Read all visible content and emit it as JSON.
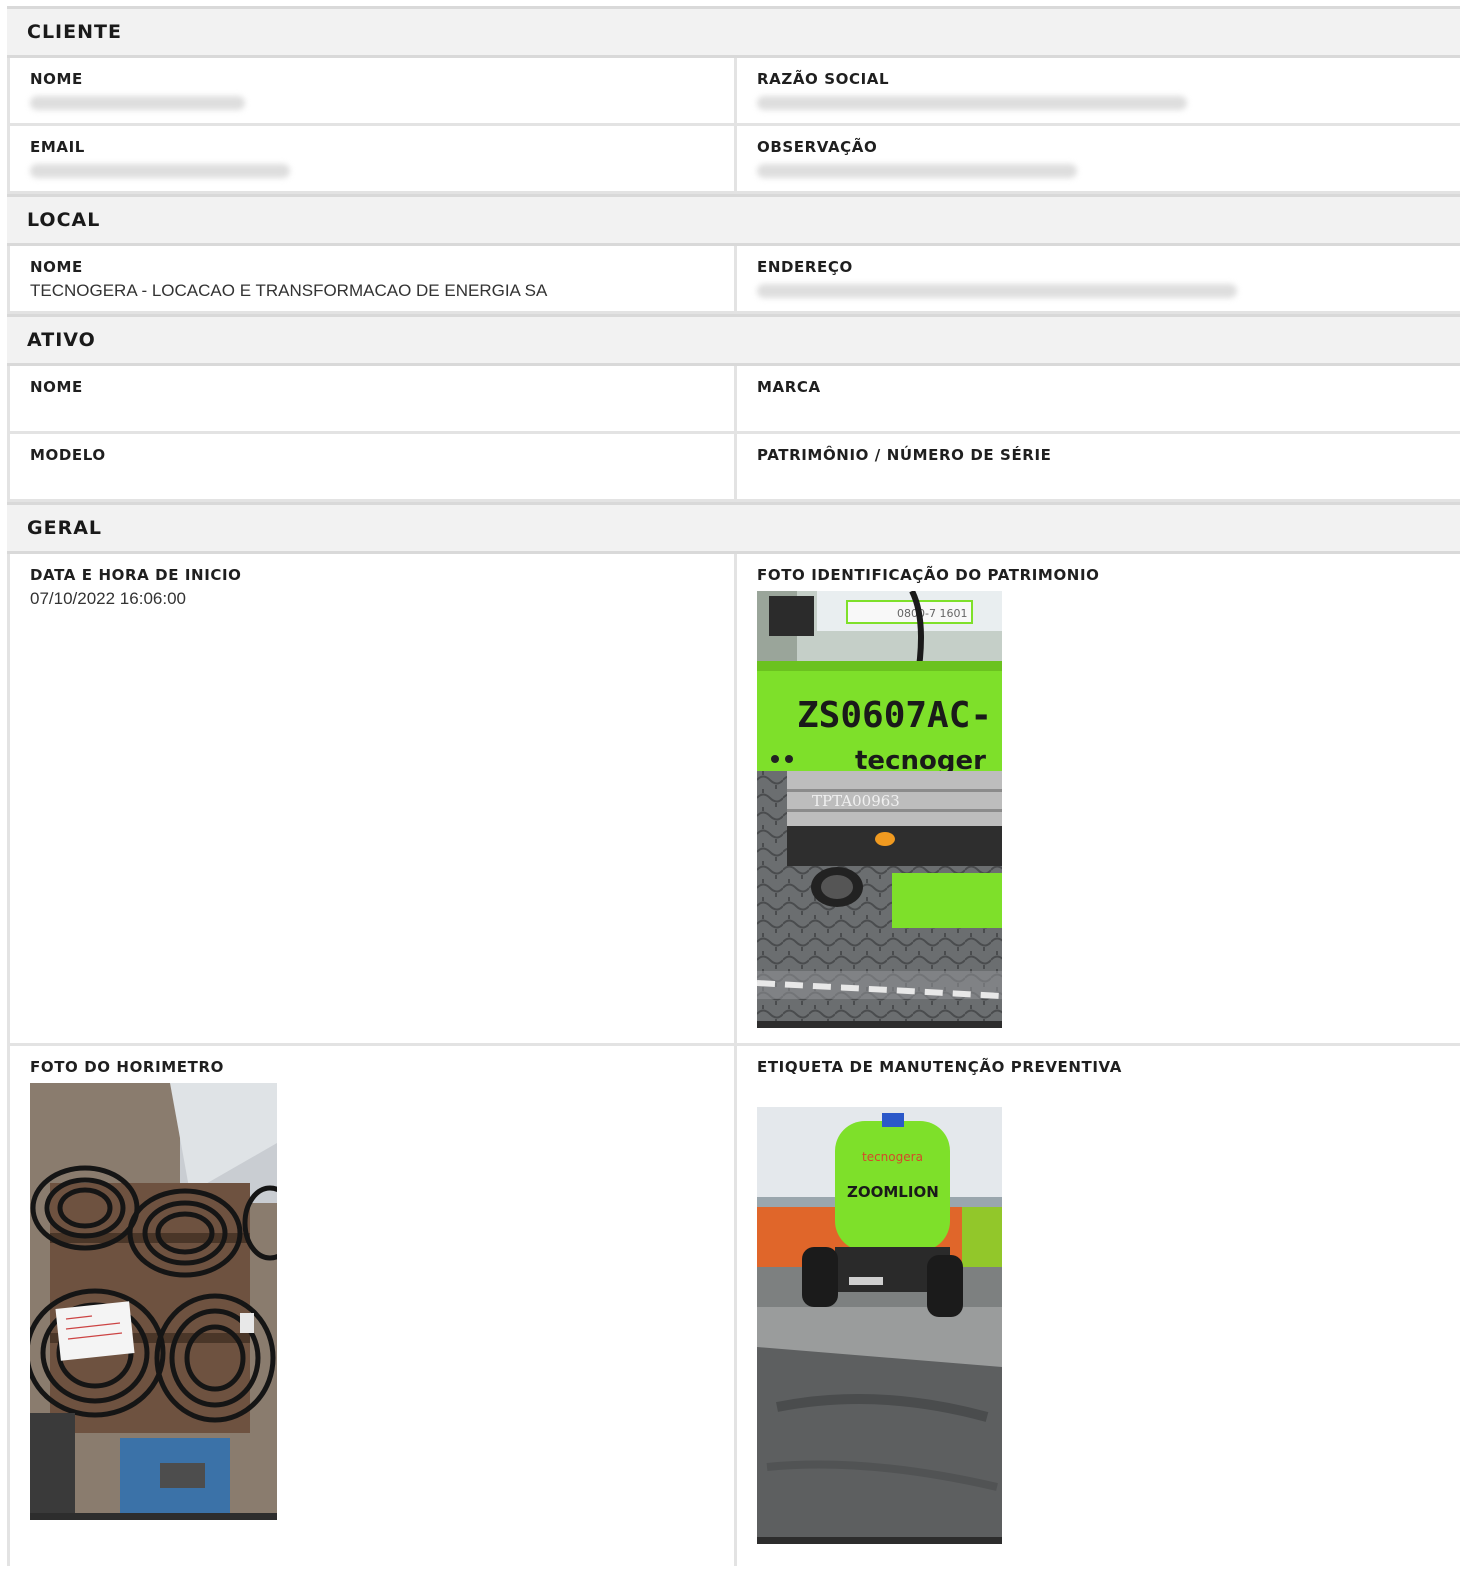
{
  "sections": {
    "cliente": {
      "title": "CLIENTE",
      "nome_label": "NOME",
      "razao_label": "RAZÃO SOCIAL",
      "email_label": "EMAIL",
      "obs_label": "OBSERVAÇÃO"
    },
    "local": {
      "title": "LOCAL",
      "nome_label": "NOME",
      "nome_value": "TECNOGERA - LOCACAO E TRANSFORMACAO DE ENERGIA SA",
      "endereco_label": "ENDEREÇO"
    },
    "ativo": {
      "title": "ATIVO",
      "nome_label": "NOME",
      "marca_label": "MARCA",
      "modelo_label": "MODELO",
      "patrimonio_label": "PATRIMÔNIO / NÚMERO DE SÉRIE"
    },
    "geral": {
      "title": "GERAL",
      "inicio_label": "DATA E HORA DE INICIO",
      "inicio_value": "07/10/2022 16:06:00",
      "foto_patrimonio_label": "FOTO IDENTIFICAÇÃO DO PATRIMONIO",
      "foto_horimetro_label": "FOTO DO HORIMETRO",
      "etiqueta_label": "ETIQUETA DE MANUTENÇÃO PREVENTIVA"
    }
  },
  "photos": {
    "patrimonio": {
      "plate_text": "ZS0607AC-",
      "brand_text": "tecnoger",
      "serial_text": "TPTA00963",
      "phone_text": "0800-7 1601"
    },
    "horimetro": {},
    "etiqueta": {
      "brand_text": "tecnogera",
      "logo_text": "ZOOMLION"
    }
  },
  "colors": {
    "header_bg": "#f2f2f2",
    "border": "#e3e3e3",
    "machine_green": "#7ee02a"
  }
}
